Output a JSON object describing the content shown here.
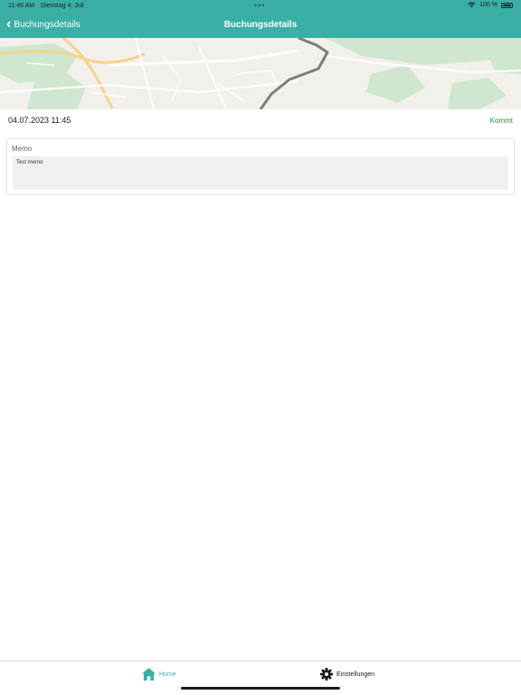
{
  "status_bar": {
    "time": "11:46 AM",
    "date": "Dienstag 4. Juli",
    "battery": "100 %"
  },
  "nav": {
    "back_label": "Buchungsdetails",
    "title": "Buchungsdetails"
  },
  "booking": {
    "datetime": "04.07.2023  11:45",
    "type": "Kommt"
  },
  "memo": {
    "label": "Memo",
    "text": "Test memo"
  },
  "tabs": [
    {
      "label": "Home",
      "icon": "home-icon",
      "active": true
    },
    {
      "label": "Einstellungen",
      "icon": "gear-icon",
      "active": false
    }
  ],
  "colors": {
    "accent": "#3aafa6",
    "status_green": "#2f8d2c",
    "memo_bg": "#eff0f0"
  }
}
